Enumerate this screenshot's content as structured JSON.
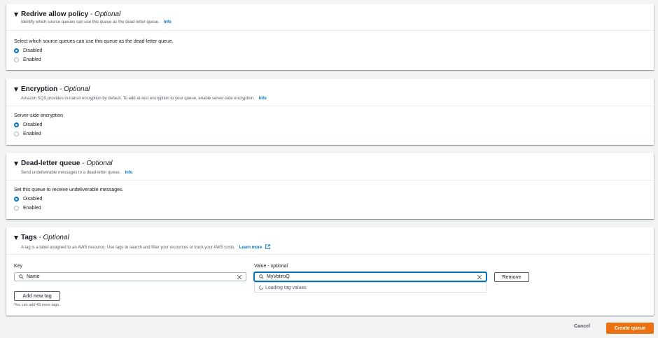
{
  "redrive": {
    "title": "Redrive allow policy",
    "optional": " - Optional",
    "description": "Identify which source queues can use this queue as the dead-letter queue.",
    "info": "Info",
    "question": "Select which source queues can use this queue as the dead-letter queue.",
    "options": [
      "Disabled",
      "Enabled"
    ],
    "selected": "Disabled"
  },
  "encryption": {
    "title": "Encryption",
    "optional": " - Optional",
    "description": "Amazon SQS provides in-transit encryption by default. To add at-rest encryption to your queue, enable server-side encryption.",
    "info": "Info",
    "question": "Server-side encryption",
    "options": [
      "Disabled",
      "Enabled"
    ],
    "selected": "Disabled"
  },
  "dlq": {
    "title": "Dead-letter queue",
    "optional": " - Optional",
    "description": "Send undeliverable messages to a dead-letter queue.",
    "info": "Info",
    "question": "Set this queue to receive undeliverable messages.",
    "options": [
      "Disabled",
      "Enabled"
    ],
    "selected": "Disabled"
  },
  "tags": {
    "title": "Tags",
    "optional": " - Optional",
    "description": "A tag is a label assigned to an AWS resource. Use tags to search and filter your resources or track your AWS costs.",
    "learn_more": "Learn more",
    "key_label": "Key",
    "value_label": "Value - ",
    "value_label_opt": "optional",
    "key_value": "Name",
    "value_value": "MyVotiroQ",
    "loading_text": "Loading tag values",
    "remove_label": "Remove",
    "add_label": "Add new tag",
    "hint": "You can add 49 more tags."
  },
  "footer": {
    "cancel_label": "Cancel",
    "create_label": "Create queue"
  },
  "colors": {
    "accent": "#0073bb",
    "primary_button": "#ec7211",
    "page_bg": "#f2f3f3"
  }
}
